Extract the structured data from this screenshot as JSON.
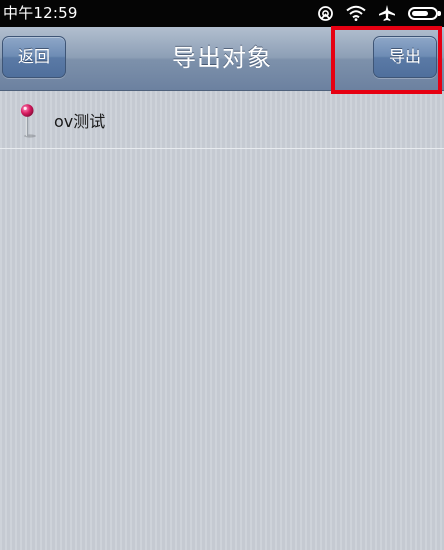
{
  "status_bar": {
    "time": "中午12:59",
    "icons": [
      "sync-icon",
      "wifi-icon",
      "airplane-icon",
      "battery-icon"
    ]
  },
  "nav": {
    "back_label": "返回",
    "title": "导出对象",
    "export_label": "导出"
  },
  "list": {
    "items": [
      {
        "label": "ov测试",
        "icon": "map-pin-icon"
      }
    ]
  },
  "colors": {
    "highlight": "#e60012",
    "nav_top": "#b2bfcf",
    "nav_bottom": "#6c81a0",
    "pin_head": "#d81b60"
  }
}
